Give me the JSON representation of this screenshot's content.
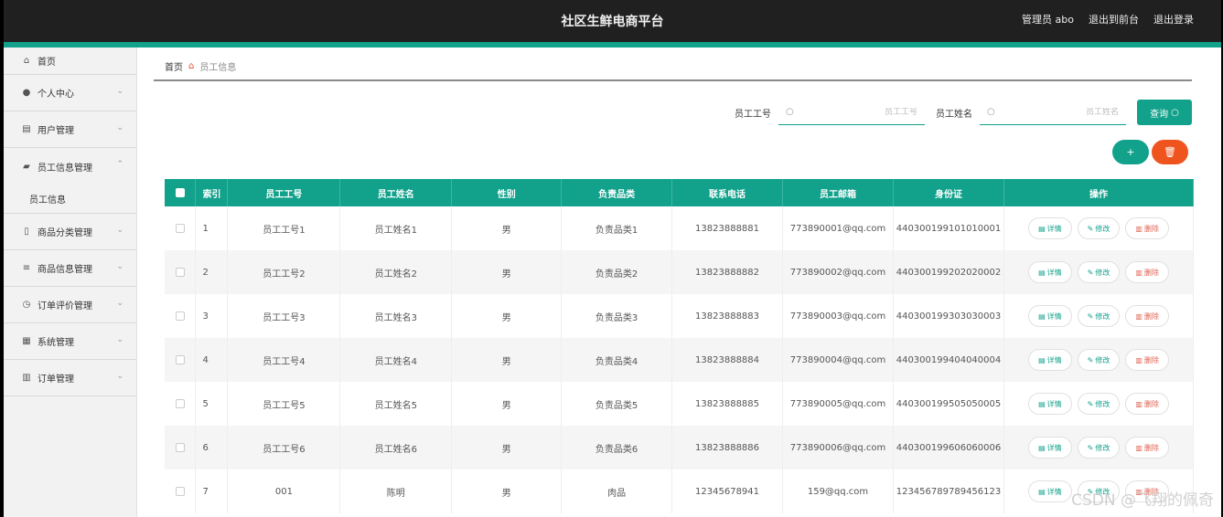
{
  "header": {
    "title": "社区生鲜电商平台",
    "user_label": "管理员 abo",
    "frontend_link": "退出到前台",
    "logout_link": "退出登录"
  },
  "colors": {
    "accent": "#12a18b",
    "danger": "#f0541e",
    "topbar": "#202020"
  },
  "sidebar": {
    "home": {
      "label": "首页",
      "icon": "home-icon"
    },
    "items": [
      {
        "label": "个人中心",
        "icon": "user-icon"
      },
      {
        "label": "用户管理",
        "icon": "users-icon"
      },
      {
        "label": "员工信息管理",
        "icon": "briefcase-icon",
        "expanded": true,
        "sub": "员工信息"
      },
      {
        "label": "商品分类管理",
        "icon": "phone-icon"
      },
      {
        "label": "商品信息管理",
        "icon": "list-icon"
      },
      {
        "label": "订单评价管理",
        "icon": "clock-icon"
      },
      {
        "label": "系统管理",
        "icon": "grid-icon"
      },
      {
        "label": "订单管理",
        "icon": "chart-icon"
      }
    ]
  },
  "breadcrumb": {
    "home": "首页",
    "current": "员工信息"
  },
  "search": {
    "id_label": "员工工号",
    "id_placeholder": "员工工号",
    "name_label": "员工姓名",
    "name_placeholder": "员工姓名",
    "query_label": "查询"
  },
  "actions": {
    "add": "+",
    "delete": "🗑"
  },
  "table": {
    "headers": [
      "索引",
      "员工工号",
      "员工姓名",
      "性别",
      "负责品类",
      "联系电话",
      "员工邮箱",
      "身份证",
      "操作"
    ],
    "op_labels": {
      "detail": "详情",
      "edit": "修改",
      "delete": "删除"
    },
    "rows": [
      {
        "idx": "1",
        "id": "员工工号1",
        "name": "员工姓名1",
        "gender": "男",
        "category": "负责品类1",
        "phone": "13823888881",
        "email": "773890001@qq.com",
        "idcard": "440300199101010001"
      },
      {
        "idx": "2",
        "id": "员工工号2",
        "name": "员工姓名2",
        "gender": "男",
        "category": "负责品类2",
        "phone": "13823888882",
        "email": "773890002@qq.com",
        "idcard": "440300199202020002"
      },
      {
        "idx": "3",
        "id": "员工工号3",
        "name": "员工姓名3",
        "gender": "男",
        "category": "负责品类3",
        "phone": "13823888883",
        "email": "773890003@qq.com",
        "idcard": "440300199303030003"
      },
      {
        "idx": "4",
        "id": "员工工号4",
        "name": "员工姓名4",
        "gender": "男",
        "category": "负责品类4",
        "phone": "13823888884",
        "email": "773890004@qq.com",
        "idcard": "440300199404040004"
      },
      {
        "idx": "5",
        "id": "员工工号5",
        "name": "员工姓名5",
        "gender": "男",
        "category": "负责品类5",
        "phone": "13823888885",
        "email": "773890005@qq.com",
        "idcard": "440300199505050005"
      },
      {
        "idx": "6",
        "id": "员工工号6",
        "name": "员工姓名6",
        "gender": "男",
        "category": "负责品类6",
        "phone": "13823888886",
        "email": "773890006@qq.com",
        "idcard": "440300199606060006"
      },
      {
        "idx": "7",
        "id": "001",
        "name": "陈明",
        "gender": "男",
        "category": "肉品",
        "phone": "12345678941",
        "email": "159@qq.com",
        "idcard": "123456789789456123"
      }
    ]
  },
  "watermark": "CSDN @飞翔的佩奇"
}
